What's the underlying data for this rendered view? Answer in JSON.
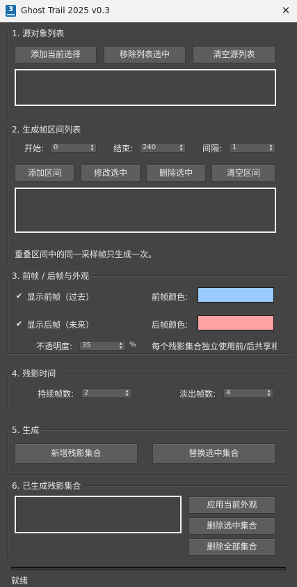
{
  "window": {
    "title": "Ghost Trail 2025  v0.3",
    "icon_text": "3",
    "close_glyph": "✕"
  },
  "colors": {
    "past_color": "#99ccff",
    "future_color": "#ffa3a3",
    "panel_bg": "#444444",
    "button_bg": "#5d5d5d"
  },
  "section1": {
    "title": "1.  源对象列表",
    "add_button": "添加当前选择",
    "remove_button": "移除列表选中",
    "clear_button": "清空源列表"
  },
  "section2": {
    "title": "2.  生成帧区间列表",
    "start_label": "开始:",
    "start_value": "0",
    "end_label": "结束:",
    "end_value": "240",
    "step_label": "间隔:",
    "step_value": "1",
    "add_button": "添加区间",
    "modify_button": "修改选中",
    "delete_button": "删除选中",
    "clear_button": "清空区间",
    "note": "重叠区间中的同一采样帧只生成一次。"
  },
  "section3": {
    "title": "3.  前帧 / 后帧与外观",
    "show_past_label": "显示前帧（过去）",
    "show_past_checked": true,
    "show_future_label": "显示后帧（未来）",
    "show_future_checked": true,
    "past_color_label": "前帧颜色:",
    "future_color_label": "后帧颜色:",
    "opacity_label": "不透明度:",
    "opacity_value": "35",
    "opacity_unit": "%",
    "note": "每个残影集合独立使用前/后共享相"
  },
  "section4": {
    "title": "4.  残影时间",
    "duration_label": "持续帧数:",
    "duration_value": "2",
    "fade_label": "淡出帧数:",
    "fade_value": "4"
  },
  "section5": {
    "title": "5.  生成",
    "new_button": "新增残影集合",
    "replace_button": "替换选中集合"
  },
  "section6": {
    "title": "6.  已生成残影集合",
    "apply_button": "应用当前外观",
    "delete_button": "删除选中集合",
    "delete_all_button": "删除全部集合"
  },
  "status": {
    "text": "就绪"
  },
  "glyphs": {
    "check": "✔",
    "spin_up": "▲",
    "spin_down": "▼"
  }
}
